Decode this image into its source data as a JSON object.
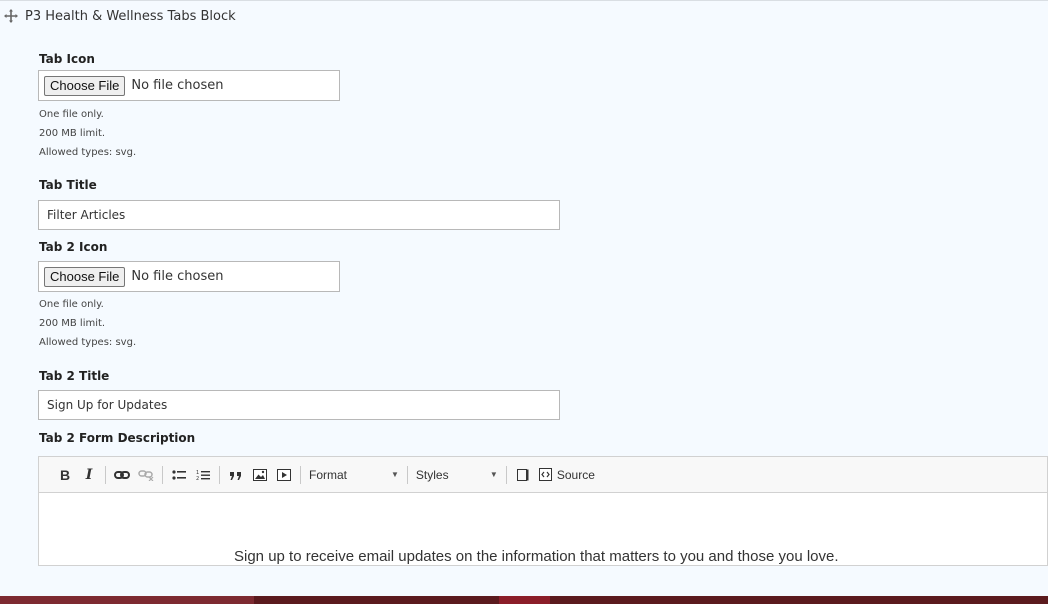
{
  "block": {
    "title": "P3 Health & Wellness Tabs Block",
    "icon": "move-drag-icon"
  },
  "tab_icon": {
    "label": "Tab Icon",
    "button": "Choose File",
    "status": "No file chosen",
    "help": [
      "One file only.",
      "200 MB limit.",
      "Allowed types: svg."
    ]
  },
  "tab_title": {
    "label": "Tab Title",
    "value": "Filter Articles"
  },
  "tab2_icon": {
    "label": "Tab 2 Icon",
    "button": "Choose File",
    "status": "No file chosen",
    "help": [
      "One file only.",
      "200 MB limit.",
      "Allowed types: svg."
    ]
  },
  "tab2_title": {
    "label": "Tab 2 Title",
    "value": "Sign Up for Updates"
  },
  "tab2_form": {
    "label": "Tab 2 Form Description",
    "toolbar": {
      "bold": "B",
      "italic": "I",
      "format": "Format",
      "styles": "Styles",
      "source": "Source",
      "icons": [
        "link-icon",
        "unlink-icon",
        "bulleted-list-icon",
        "numbered-list-icon",
        "blockquote-icon",
        "image-icon",
        "media-icon",
        "maximize-icon",
        "source-icon"
      ]
    },
    "content": "Sign up to receive email updates on the information that matters to you and those you love."
  },
  "colors": {
    "panel": "#f5faff",
    "footer": "#5b1a1e",
    "footer_accent": "#8b1d29"
  }
}
